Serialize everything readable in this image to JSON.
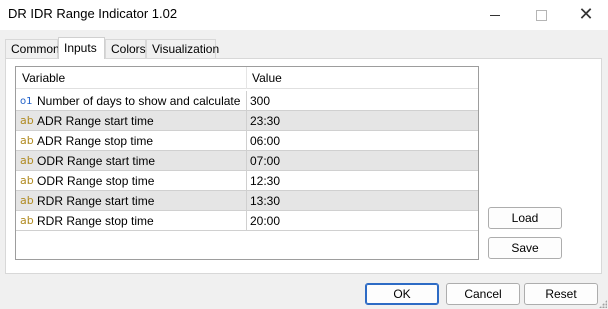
{
  "window": {
    "title": "DR IDR Range Indicator 1.02",
    "controls": {
      "minimize": "minimize-icon",
      "maximize": "maximize-icon",
      "close": "close-icon"
    }
  },
  "tabs": [
    {
      "label": "Common",
      "active": false
    },
    {
      "label": "Inputs",
      "active": true
    },
    {
      "label": "Colors",
      "active": false
    },
    {
      "label": "Visualization",
      "active": false
    }
  ],
  "grid": {
    "headers": {
      "variable": "Variable",
      "value": "Value"
    },
    "rows": [
      {
        "icon": "o1",
        "type": "integer",
        "name": "Number of days to show and calculate",
        "value": "300"
      },
      {
        "icon": "ab",
        "type": "string",
        "name": "ADR Range start time",
        "value": "23:30"
      },
      {
        "icon": "ab",
        "type": "string",
        "name": "ADR Range stop time",
        "value": "06:00"
      },
      {
        "icon": "ab",
        "type": "string",
        "name": "ODR Range start time",
        "value": "07:00"
      },
      {
        "icon": "ab",
        "type": "string",
        "name": "ODR Range stop time",
        "value": "12:30"
      },
      {
        "icon": "ab",
        "type": "string",
        "name": "RDR Range start time",
        "value": "13:30"
      },
      {
        "icon": "ab",
        "type": "string",
        "name": "RDR Range stop time",
        "value": "20:00"
      }
    ]
  },
  "side_buttons": {
    "load": "Load",
    "save": "Save"
  },
  "footer": {
    "ok": "OK",
    "cancel": "Cancel",
    "reset": "Reset"
  },
  "colors": {
    "integer_icon": "#2060c8",
    "string_icon": "#b08a20",
    "row_shade": "#e5e5e5",
    "ok_border": "#2d6bc5"
  }
}
